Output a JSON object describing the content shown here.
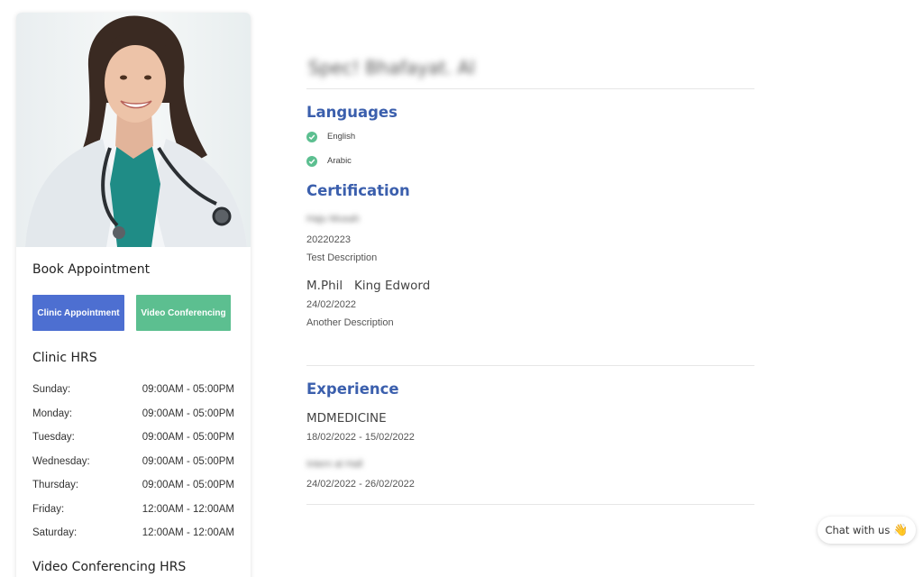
{
  "sidebar": {
    "book_title": "Book Appointment",
    "clinic_btn": "Clinic Appointment",
    "video_btn": "Video Conferencing",
    "clinic_hrs_title": "Clinic HRS",
    "hours": [
      {
        "day": "Sunday:",
        "time": "09:00AM - 05:00PM"
      },
      {
        "day": "Monday:",
        "time": "09:00AM - 05:00PM"
      },
      {
        "day": "Tuesday:",
        "time": "09:00AM - 05:00PM"
      },
      {
        "day": "Wednesday:",
        "time": "09:00AM - 05:00PM"
      },
      {
        "day": "Thursday:",
        "time": "09:00AM - 05:00PM"
      },
      {
        "day": "Friday:",
        "time": "12:00AM - 12:00AM"
      },
      {
        "day": "Saturday:",
        "time": "12:00AM - 12:00AM"
      }
    ],
    "video_hrs_title": "Video Conferencing HRS"
  },
  "profile": {
    "name": "Spec! Bhafayat. Al",
    "languages_heading": "Languages",
    "languages": [
      "English",
      "Arabic"
    ],
    "certification_heading": "Certification",
    "certifications": [
      {
        "title": "Haju Musah",
        "date": "20220223",
        "description": "Test Description"
      },
      {
        "title": "M.Phil   King Edword",
        "date": "24/02/2022",
        "description": "Another Description"
      }
    ],
    "experience_heading": "Experience",
    "experience": [
      {
        "title": "MDMEDICINE",
        "dates": "18/02/2022 - 15/02/2022"
      },
      {
        "title": "Intern at Hall",
        "dates": "24/02/2022 - 26/02/2022"
      }
    ]
  },
  "chat": {
    "label": "Chat with us",
    "icon": "waving-hand-icon"
  },
  "colors": {
    "primary": "#4d6fd1",
    "accent": "#5cbf90",
    "heading": "#3b5fad"
  }
}
